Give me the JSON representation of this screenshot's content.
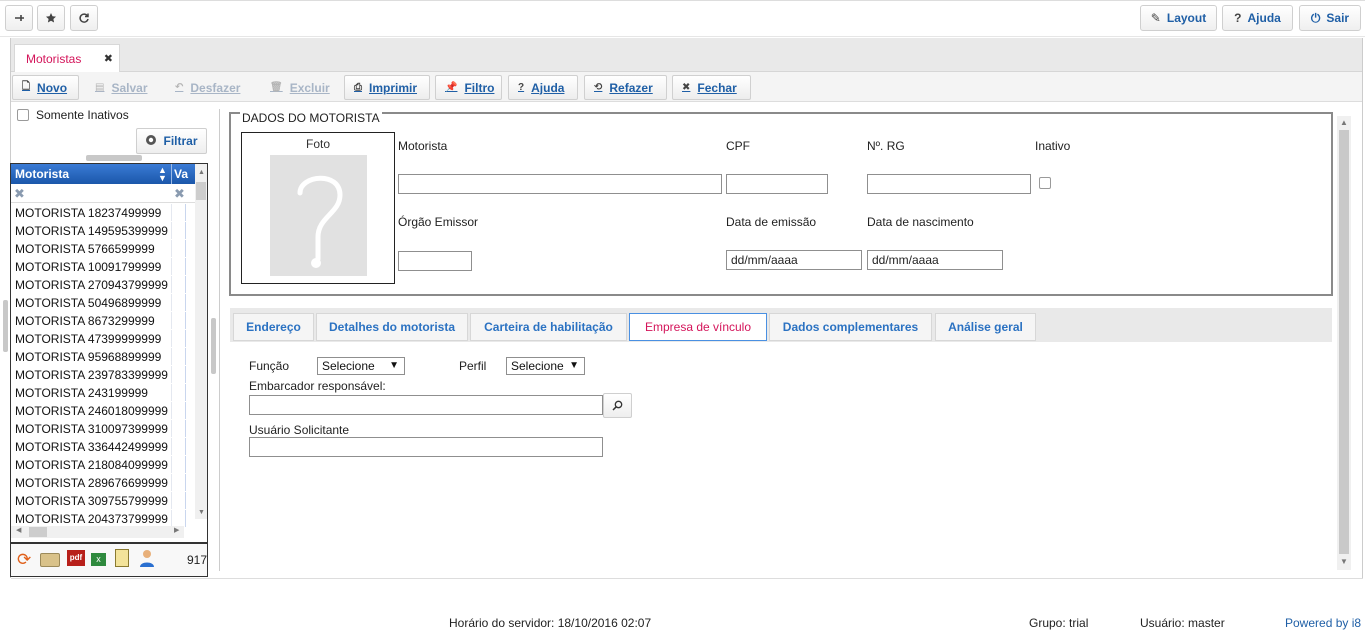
{
  "topbar": {
    "left_icons": [
      "pin-icon",
      "star-icon",
      "refresh-icon"
    ],
    "layout_label": "Layout",
    "help_label": "Ajuda",
    "exit_label": "Sair"
  },
  "main_tab": {
    "label": "Motoristas",
    "close": "✖"
  },
  "toolbar": {
    "novo": "Novo",
    "salvar": "Salvar",
    "desfazer": "Desfazer",
    "excluir": "Excluir",
    "imprimir": "Imprimir",
    "filtro": "Filtro",
    "ajuda": "Ajuda",
    "refazer": "Refazer",
    "fechar": "Fechar"
  },
  "left": {
    "only_inactive": "Somente Inativos",
    "filter_button": "Filtrar",
    "grid": {
      "col1": "Motorista",
      "col2": "Va",
      "rows": [
        "MOTORISTA 18237499999",
        "MOTORISTA 149595399999",
        "MOTORISTA 5766599999",
        "MOTORISTA 10091799999",
        "MOTORISTA 270943799999",
        "MOTORISTA 50496899999",
        "MOTORISTA 8673299999",
        "MOTORISTA 47399999999",
        "MOTORISTA 95968899999",
        "MOTORISTA 239783399999",
        "MOTORISTA 243199999",
        "MOTORISTA 246018099999",
        "MOTORISTA 310097399999",
        "MOTORISTA 336442499999",
        "MOTORISTA 218084099999",
        "MOTORISTA 289676699999",
        "MOTORISTA 309755799999",
        "MOTORISTA 204373799999"
      ],
      "count": "917",
      "pdf_label": "pdf"
    }
  },
  "form": {
    "legend": "DADOS DO MOTORISTA",
    "photo_label": "Foto",
    "motorista_label": "Motorista",
    "cpf_label": "CPF",
    "rg_label": "Nº. RG",
    "inativo_label": "Inativo",
    "orgao_label": "Órgão Emissor",
    "data_emissao_label": "Data de emissão",
    "data_nascimento_label": "Data de nascimento",
    "data_emissao_value": "dd/mm/aaaa",
    "data_nascimento_value": "dd/mm/aaaa"
  },
  "subtabs": [
    "Endereço",
    "Detalhes do motorista",
    "Carteira de habilitação",
    "Empresa de vínculo",
    "Dados complementares",
    "Análise geral"
  ],
  "vinculo": {
    "funcao_label": "Função",
    "funcao_value": "Selecione",
    "perfil_label": "Perfil",
    "perfil_value": "Selecione",
    "embarcador_label": "Embarcador responsável:",
    "usuario_label": "Usuário Solicitante"
  },
  "footer": {
    "server_time": "Horário do servidor: 18/10/2016 02:07",
    "group": "Grupo: trial",
    "user": "Usuário: master",
    "powered": "Powered by i8"
  },
  "colors": {
    "accent": "#d4145a",
    "link": "#1f5fa6",
    "grid_header": "#1b57aa"
  }
}
